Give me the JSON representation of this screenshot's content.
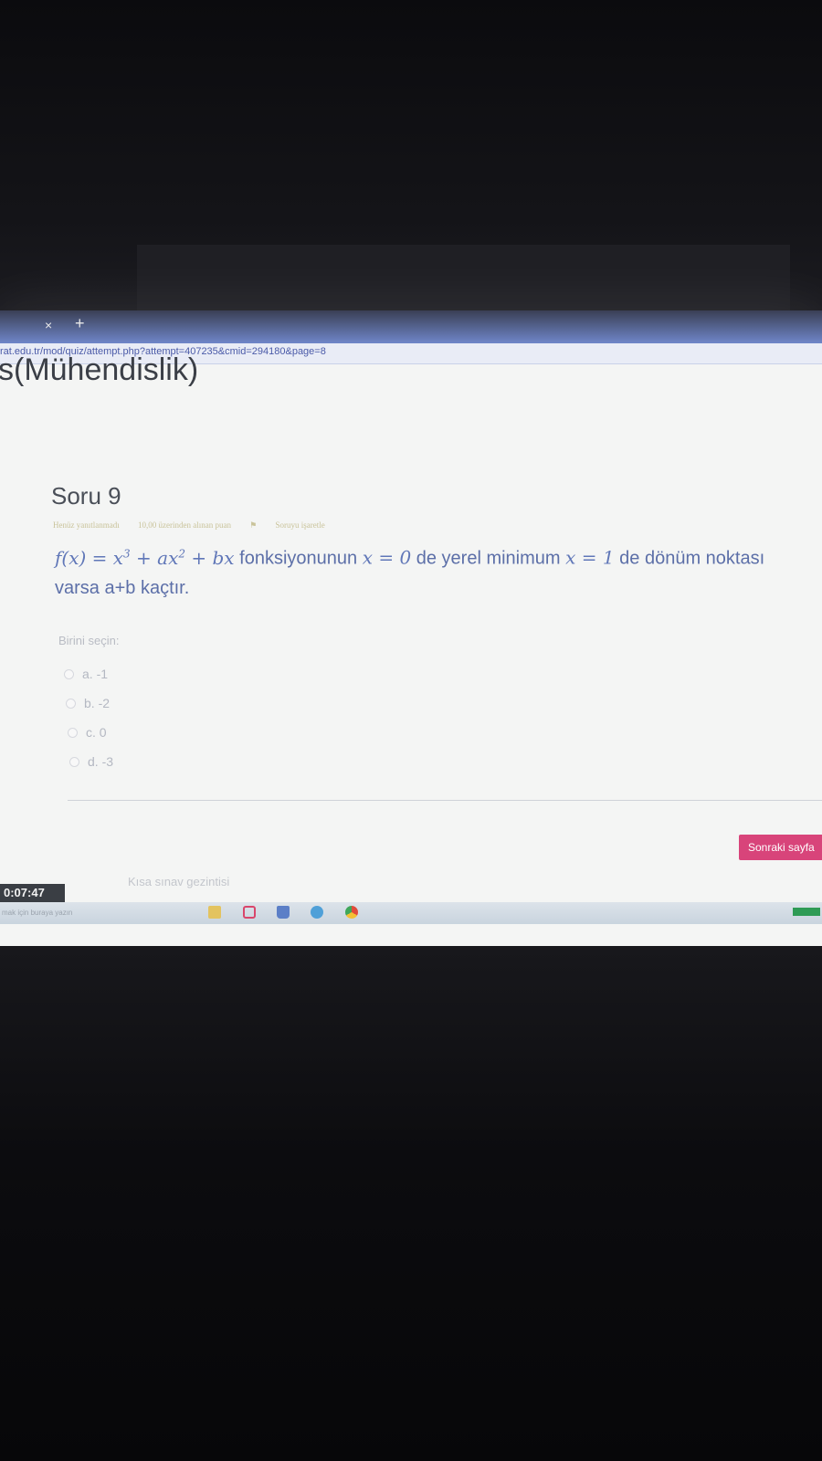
{
  "browser": {
    "tab_close": "×",
    "tab_new": "+",
    "url": "rat.edu.tr/mod/quiz/attempt.php?attempt=407235&cmid=294180&page=8"
  },
  "page": {
    "course_title": "s(Mühendislik)"
  },
  "question": {
    "title": "Soru 9",
    "status": "Henüz yanıtlanmadı",
    "points": "10,00 üzerinden alınan puan",
    "flag_label": "Soruyu işaretle",
    "text_math_1": "f(x) = x",
    "text_math_1_sup1": "3",
    "text_math_1_mid": " + ax",
    "text_math_1_sup2": "2",
    "text_math_1_end": " + bx",
    "text_part_1": " fonksiyonunun ",
    "text_math_2": "x = 0",
    "text_part_2": " de yerel minimum ",
    "text_math_3": "x = 1",
    "text_part_3": " de dönüm noktası",
    "text_line_2": "varsa a+b kaçtır.",
    "choose_label": "Birini seçin:",
    "options": [
      {
        "label": "a. -1"
      },
      {
        "label": "b. -2"
      },
      {
        "label": "c. 0"
      },
      {
        "label": "d. -3"
      }
    ]
  },
  "navigation": {
    "next_label": "Sonraki sayfa",
    "quiz_nav_label": "Kısa sınav gezintisi",
    "timer": "0:07:47"
  },
  "taskbar": {
    "search_text": "mak için buraya yazın"
  },
  "colors": {
    "next_button": "#d8447a",
    "tabbar": "#6f86c9",
    "question_text": "#5c6fa8"
  }
}
